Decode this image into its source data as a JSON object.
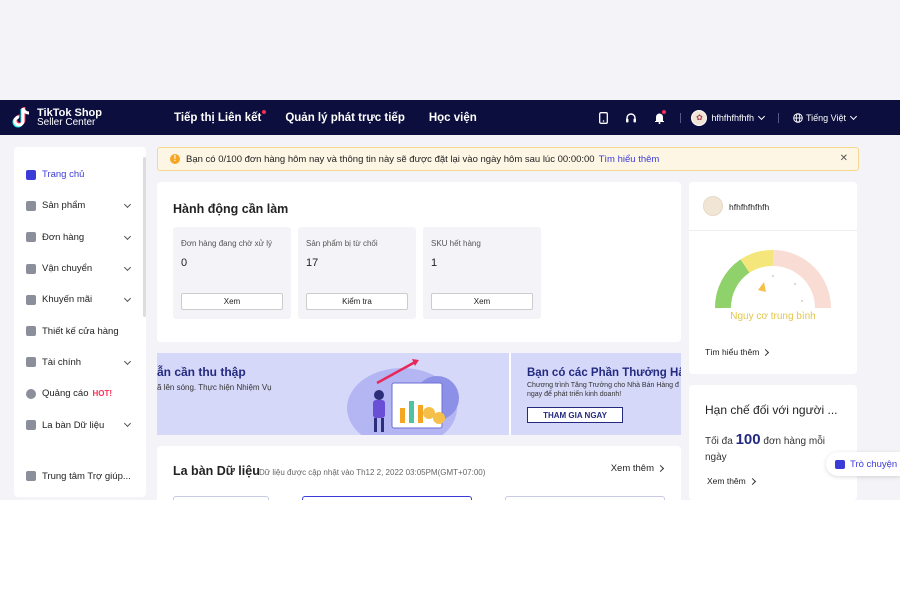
{
  "brand": {
    "line1": "TikTok Shop",
    "line2": "Seller Center"
  },
  "nav": {
    "links": [
      "Tiếp thị Liên kết",
      "Quản lý phát trực tiếp",
      "Học viện"
    ],
    "user": "hfhfhfhfhfh",
    "language": "Tiếng Việt"
  },
  "sidebar": {
    "items": [
      {
        "label": "Trang chủ"
      },
      {
        "label": "Sản phẩm"
      },
      {
        "label": "Đơn hàng"
      },
      {
        "label": "Vận chuyển"
      },
      {
        "label": "Khuyến mãi"
      },
      {
        "label": "Thiết kế cửa hàng"
      },
      {
        "label": "Tài chính"
      },
      {
        "label": "Quảng cáo",
        "badge": "HOT!"
      },
      {
        "label": "La bàn Dữ liệu"
      },
      {
        "label": "Trung tâm Trợ giúp..."
      }
    ]
  },
  "banner": {
    "text": "Bạn có 0/100 đơn hàng hôm nay và thông tin này sẽ được đặt lại vào ngày hôm sau lúc 00:00:00",
    "link": "Tìm hiểu thêm"
  },
  "actions": {
    "title": "Hành động cần làm",
    "tiles": [
      {
        "label": "Đơn hàng đang chờ xử lý",
        "value": "0",
        "button": "Xem"
      },
      {
        "label": "Sản phẩm bị từ chối",
        "value": "17",
        "button": "Kiểm tra"
      },
      {
        "label": "SKU hết hàng",
        "value": "1",
        "button": "Xem"
      }
    ]
  },
  "promo": {
    "left_title": "ẫn cần thu thập",
    "left_sub": "ã lên sóng. Thực hiện Nhiệm Vụ",
    "right_title": "Bạn có các Phần Thưởng Hấp D",
    "right_sub1": "Chương trình Tăng Trưởng cho Nhà Bán Hàng đ",
    "right_sub2": "ngay để phát triển kinh doanh!",
    "button": "THAM GIA NGAY"
  },
  "compass": {
    "title": "La bàn Dữ liệu",
    "updated": "Dữ liệu được cập nhật vào Th12 2, 2022 03:05PM(GMT+07:00)",
    "more": "Xem thêm"
  },
  "profile": {
    "name": "hfhfhfhfhfh",
    "risk": "Nguy cơ trung bình",
    "learn": "Tìm hiểu thêm"
  },
  "limits": {
    "title": "Hạn chế đối với người ...",
    "prefix": "Tối đa",
    "number": "100",
    "suffix": "đơn hàng mỗi ngày",
    "more": "Xem thêm"
  },
  "chat": {
    "label": "Trò chuyện"
  },
  "colors": {
    "navbar": "#0c0e3d",
    "accent": "#3b3bd8",
    "hot": "#fe2c55",
    "risk": "#e4c54a"
  }
}
